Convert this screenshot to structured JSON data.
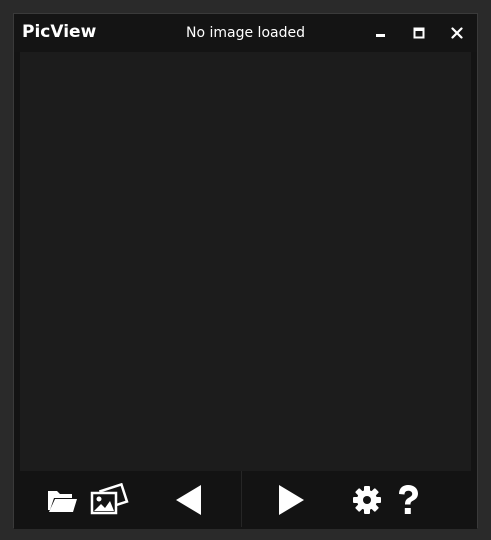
{
  "window": {
    "app_title": "PicView",
    "document_title": "No image loaded"
  },
  "titlebar_buttons": {
    "minimize": "minimize-icon",
    "maximize": "maximize-icon",
    "close": "close-icon"
  },
  "toolbar": {
    "buttons": [
      {
        "name": "open-folder-button",
        "icon": "folder-icon"
      },
      {
        "name": "gallery-button",
        "icon": "images-icon"
      },
      {
        "name": "previous-button",
        "icon": "triangle-left-icon"
      },
      {
        "name": "next-button",
        "icon": "triangle-right-icon"
      },
      {
        "name": "settings-button",
        "icon": "gear-icon"
      },
      {
        "name": "help-button",
        "icon": "question-mark-icon"
      }
    ]
  },
  "colors": {
    "background": "#131313",
    "viewer": "#1c1c1c",
    "foreground": "#ffffff"
  }
}
